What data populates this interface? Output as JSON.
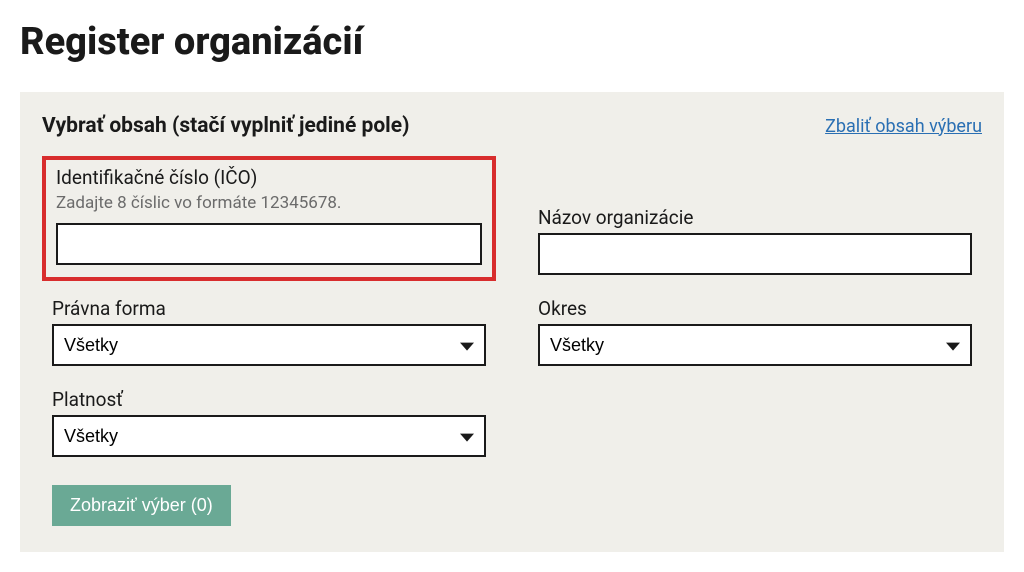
{
  "page": {
    "title": "Register organizácií"
  },
  "panel": {
    "title": "Vybrať obsah (stačí vyplniť jediné pole)",
    "collapse_link": "Zbaliť obsah výberu"
  },
  "fields": {
    "ico": {
      "label": "Identifikačné číslo (IČO)",
      "hint": "Zadajte 8 číslic vo formáte 12345678.",
      "value": ""
    },
    "org_name": {
      "label": "Názov organizácie",
      "value": ""
    },
    "legal_form": {
      "label": "Právna forma",
      "selected": "Všetky"
    },
    "district": {
      "label": "Okres",
      "selected": "Všetky"
    },
    "validity": {
      "label": "Platnosť",
      "selected": "Všetky"
    }
  },
  "actions": {
    "submit": "Zobraziť výber (0)"
  }
}
